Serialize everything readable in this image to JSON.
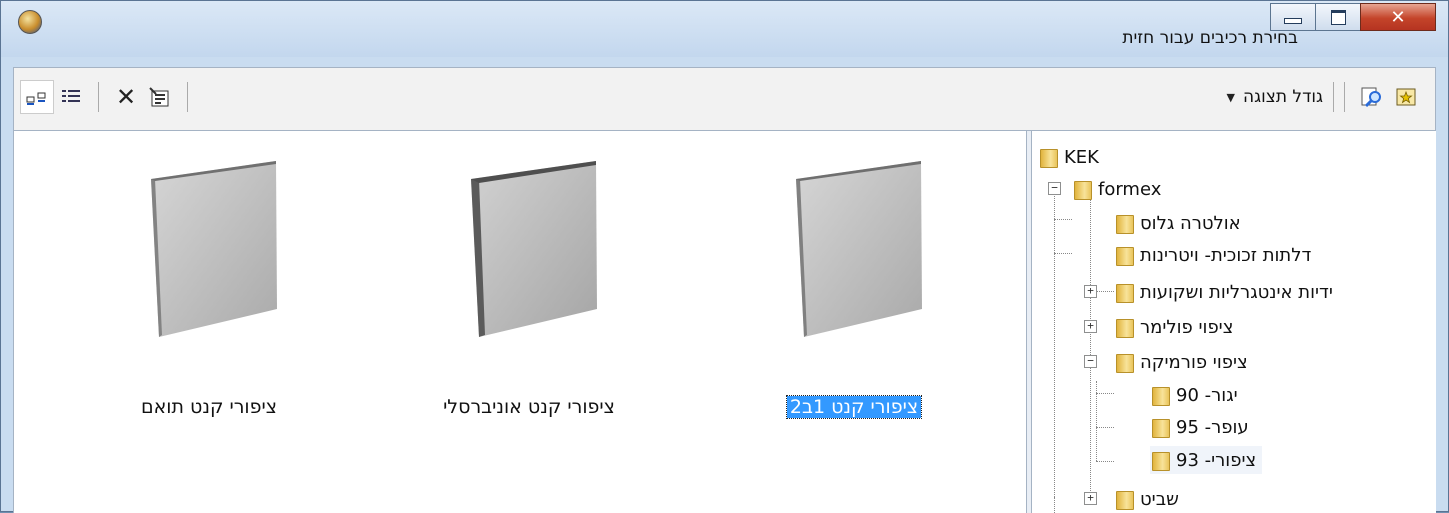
{
  "window": {
    "title": "בחירת רכיבים עבור חזית"
  },
  "toolbar": {
    "display_size_label": "גודל תצוגה"
  },
  "tiles": [
    {
      "label": "ציפורי קנט 1ב2",
      "selected": true
    },
    {
      "label": "ציפורי קנט אוניברסלי",
      "selected": false
    },
    {
      "label": "ציפורי קנט תואם",
      "selected": false
    }
  ],
  "tree": {
    "root": "KEK",
    "formex": "formex",
    "items": [
      "אולטרה גלוס",
      "דלתות זכוכית- ויטרינות",
      "ידיות אינטגרליות ושקועות",
      "ציפוי פולימר",
      "ציפוי פורמיקה"
    ],
    "children": [
      "יגור- 90",
      "עופר- 95",
      "ציפורי- 93"
    ],
    "last": "שביט"
  },
  "colors": {
    "selection": "#3399ff",
    "titlebar": "#c3d7ee",
    "close": "#c4442a"
  }
}
